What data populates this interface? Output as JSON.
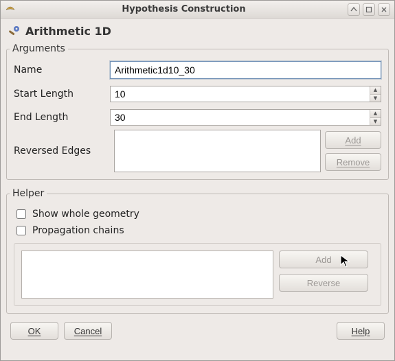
{
  "window": {
    "title": "Hypothesis Construction"
  },
  "dialog": {
    "title": "Arithmetic 1D"
  },
  "arguments": {
    "legend": "Arguments",
    "name_label": "Name",
    "name_value": "Arithmetic1d10_30",
    "start_label": "Start Length",
    "start_value": "10",
    "end_label": "End Length",
    "end_value": "30",
    "reversed_label": "Reversed Edges",
    "add_btn": "Add",
    "remove_btn": "Remove"
  },
  "helper": {
    "legend": "Helper",
    "show_whole": "Show whole geometry",
    "show_whole_checked": false,
    "propagation": "Propagation chains",
    "propagation_checked": false,
    "add_btn": "Add",
    "reverse_btn": "Reverse"
  },
  "buttons": {
    "ok": "OK",
    "cancel": "Cancel",
    "help": "Help"
  },
  "icons": {
    "app": "bird-icon",
    "dialog": "wrench-gear-icon"
  }
}
